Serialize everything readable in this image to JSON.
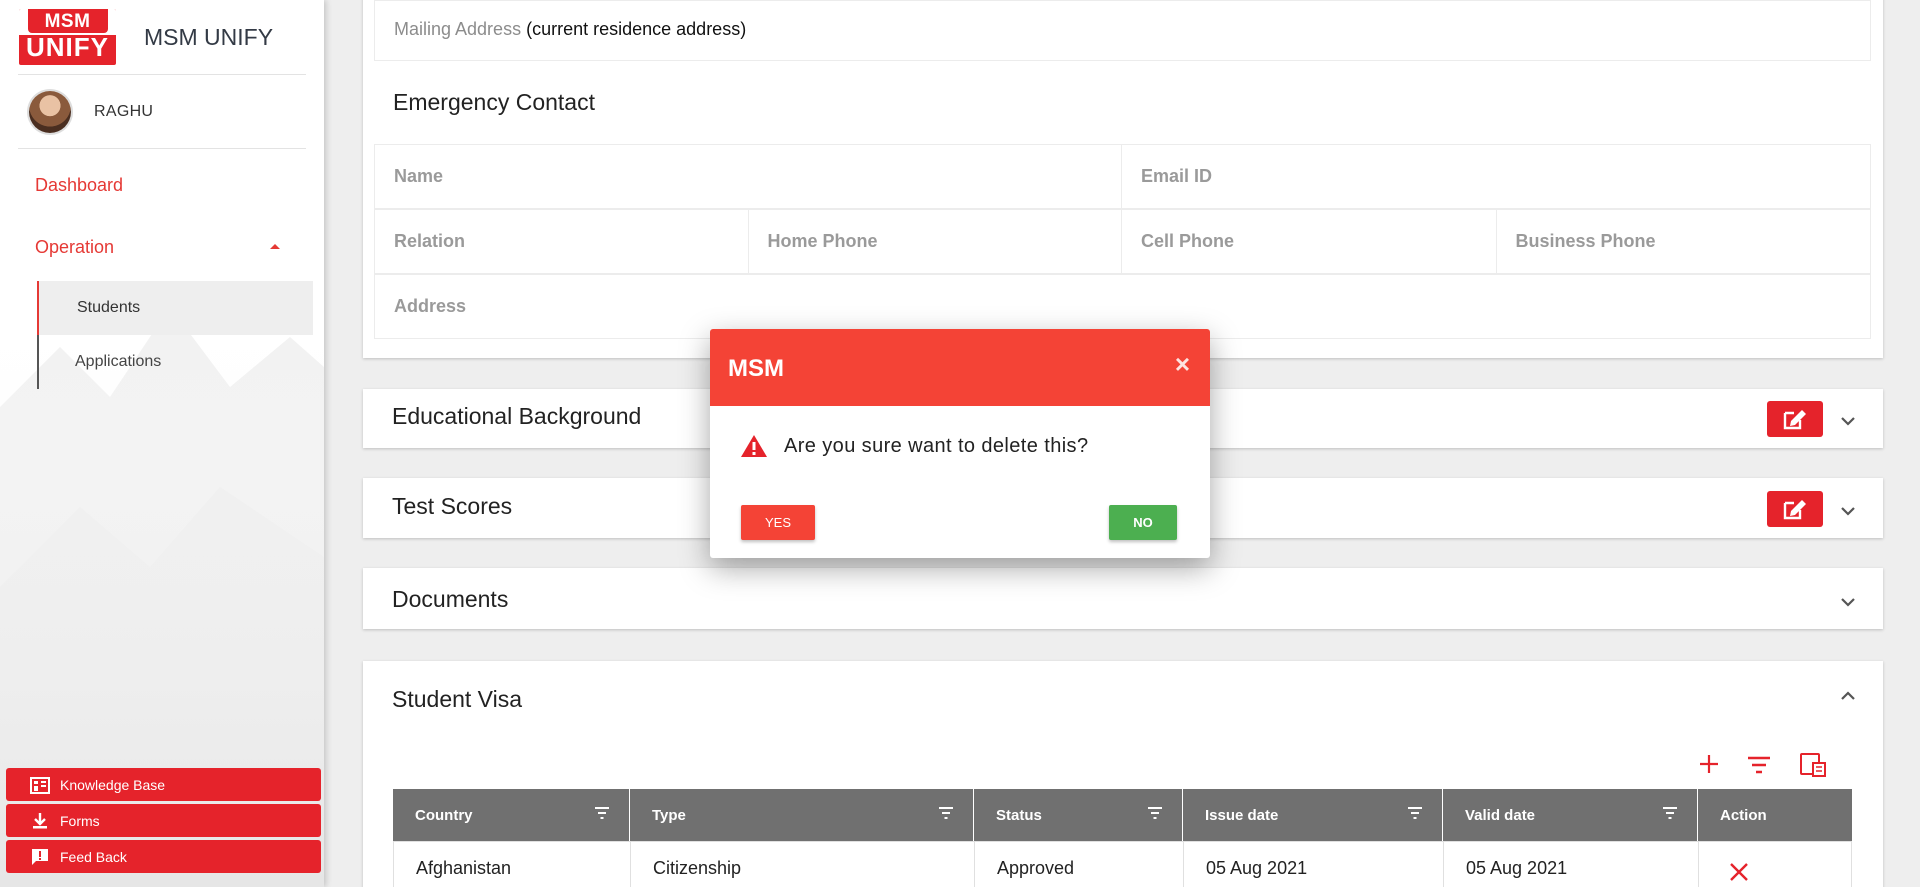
{
  "app": {
    "logo_top": "MSM",
    "logo_bottom": "UNIFY",
    "title": "MSM UNIFY"
  },
  "user": {
    "name": "RAGHU"
  },
  "sidebar": {
    "nav": [
      {
        "label": "Dashboard"
      },
      {
        "label": "Operation"
      }
    ],
    "subnav": [
      {
        "label": "Students",
        "active": true
      },
      {
        "label": "Applications"
      }
    ],
    "bottom_buttons": [
      {
        "label": "Knowledge Base",
        "icon": "building-icon"
      },
      {
        "label": "Forms",
        "icon": "download-icon"
      },
      {
        "label": "Feed Back",
        "icon": "feedback-icon"
      }
    ]
  },
  "mailing": {
    "label": "Mailing Address",
    "note": "(current residence address)"
  },
  "emergency": {
    "title": "Emergency Contact",
    "fields": {
      "name": "Name",
      "email": "Email ID",
      "relation": "Relation",
      "home_phone": "Home Phone",
      "cell_phone": "Cell Phone",
      "business_phone": "Business Phone",
      "address": "Address"
    }
  },
  "accordions": {
    "education": "Educational Background",
    "tests": "Test Scores",
    "documents": "Documents",
    "visa": "Student Visa"
  },
  "visa_table": {
    "columns": [
      "Country",
      "Type",
      "Status",
      "Issue date",
      "Valid date",
      "Action"
    ],
    "rows": [
      {
        "country": "Afghanistan",
        "type": "Citizenship",
        "status": "Approved",
        "issue_date": "05 Aug 2021",
        "valid_date": "05 Aug 2021"
      }
    ]
  },
  "modal": {
    "title": "MSM",
    "message": "Are you sure want to delete this?",
    "yes_label": "YES",
    "no_label": "NO"
  },
  "colors": {
    "accent": "#e5232b",
    "modal_header": "#f44336",
    "no_button": "#4caf50",
    "table_header": "#707070"
  }
}
